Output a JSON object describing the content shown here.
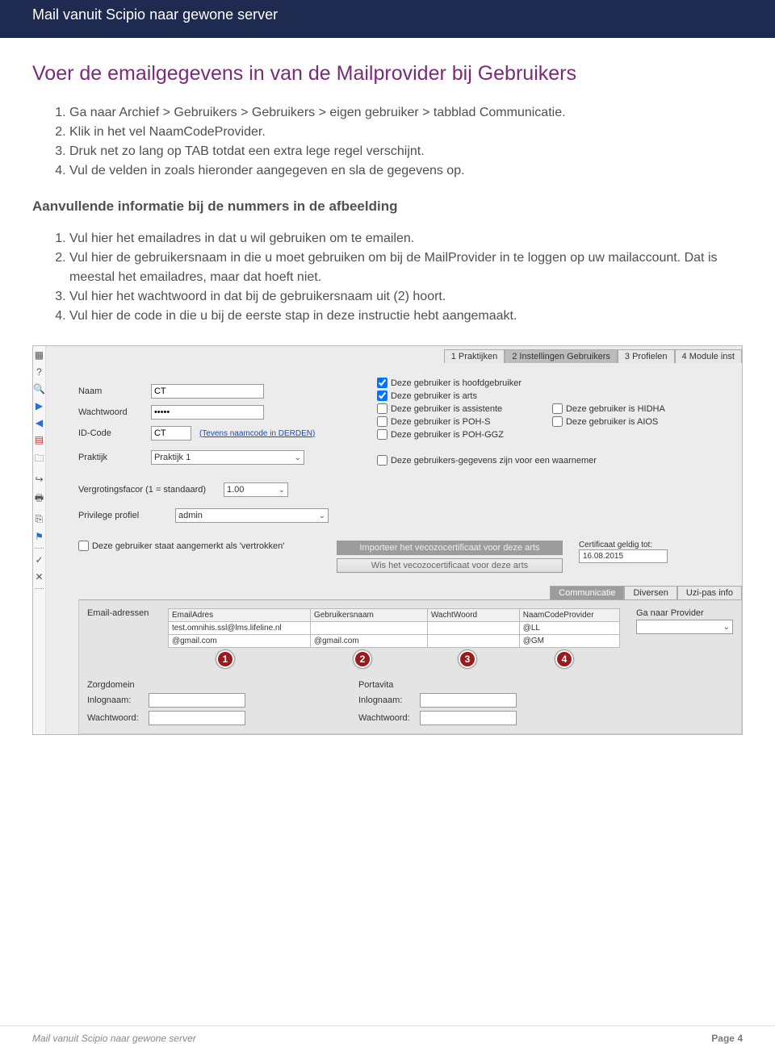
{
  "header": {
    "title": "Mail vanuit Scipio naar gewone server"
  },
  "section": {
    "title": "Voer de emailgegevens in van de Mailprovider bij Gebruikers"
  },
  "steps": [
    "Ga naar Archief > Gebruikers > Gebruikers > eigen gebruiker > tabblad Communicatie.",
    "Klik in het vel NaamCodeProvider.",
    "Druk net zo lang op TAB totdat een extra lege regel verschijnt.",
    "Vul de velden in zoals hieronder aangegeven en sla de gegevens op."
  ],
  "subheading": "Aanvullende informatie bij de nummers in de afbeelding",
  "notes": [
    "Vul hier het emailadres in dat u wil gebruiken om te emailen.",
    "Vul hier de gebruikersnaam in die u moet gebruiken om bij de MailProvider in te loggen op uw mailaccount. Dat is meestal het emailadres, maar dat hoeft niet.",
    "Vul hier het wachtwoord in dat bij de gebruikersnaam uit (2) hoort.",
    "Vul hier de code in die u bij de eerste stap in deze instructie hebt aangemaakt."
  ],
  "ui": {
    "topTabs": [
      "1 Praktijken",
      "2 Instellingen Gebruikers",
      "3 Profielen",
      "4 Module inst"
    ],
    "topTabActive": 1,
    "labels": {
      "naam": "Naam",
      "wachtwoord": "Wachtwoord",
      "idcode": "ID-Code",
      "praktijk": "Praktijk",
      "derdenLink": "(Tevens naamcode in DERDEN)",
      "vergroting": "Vergrotingsfacor (1 = standaard)",
      "privilege": "Privilege profiel",
      "vertrokken": "Deze gebruiker staat aangemerkt als 'vertrokken'",
      "certLabel": "Certificaat geldig tot:",
      "emailAdressen": "Email-adressen",
      "gaNaarProvider": "Ga naar Provider",
      "zorgdomein": "Zorgdomein",
      "portavita": "Portavita",
      "inlognaam": "Inlognaam:",
      "wachtw": "Wachtwoord:"
    },
    "values": {
      "naam": "CT",
      "wachtwoord": "•••••",
      "idcode": "CT",
      "praktijk": "Praktijk 1",
      "vergroting": "1.00",
      "privilege": "admin",
      "certDate": "16.08.2015"
    },
    "checks": {
      "hoofd": "Deze gebruiker is hoofdgebruiker",
      "arts": "Deze gebruiker is arts",
      "assist": "Deze gebruiker is assistente",
      "pohs": "Deze gebruiker is POH-S",
      "pohggz": "Deze gebruiker is POH-GGZ",
      "hidha": "Deze gebruiker is HIDHA",
      "aios": "Deze gebruiker is AIOS",
      "waarnemer": "Deze gebruikers-gegevens zijn voor een waarnemer"
    },
    "buttons": {
      "import": "Importeer het vecozocertificaat  voor deze arts",
      "wis": "Wis het vecozocertificaat  voor deze arts"
    },
    "subTabs": [
      "Communicatie",
      "Diversen",
      "Uzi-pas info"
    ],
    "subTabActive": 0,
    "emailTable": {
      "headers": [
        "EmailAdres",
        "Gebruikersnaam",
        "WachtWoord",
        "NaamCodeProvider"
      ],
      "rows": [
        [
          "test.omnihis.ssl@lms.lifeline.nl",
          "",
          "",
          "@LL"
        ],
        [
          "            @gmail.com",
          "        @gmail.com",
          "",
          "@GM"
        ]
      ]
    },
    "badges": [
      "1",
      "2",
      "3",
      "4"
    ]
  },
  "footer": {
    "left": "Mail vanuit Scipio naar gewone server",
    "right": "Page 4"
  }
}
